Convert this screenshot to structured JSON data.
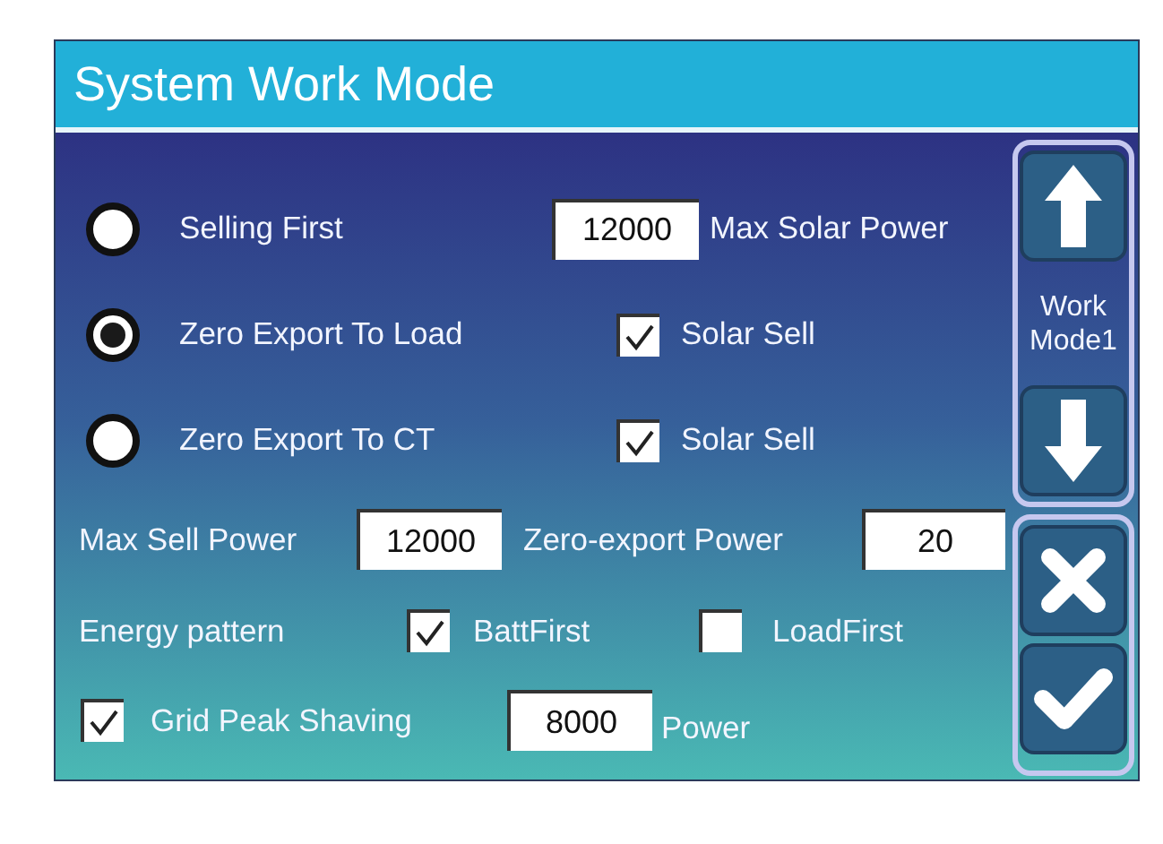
{
  "title": "System Work Mode",
  "modes": [
    {
      "label": "Selling First",
      "selected": false,
      "kind": "field",
      "value": "12000",
      "extra_label": "Max Solar Power"
    },
    {
      "label": "Zero Export To Load",
      "selected": true,
      "kind": "checkbox",
      "checked": true,
      "extra_label": "Solar Sell"
    },
    {
      "label": "Zero Export To CT",
      "selected": false,
      "kind": "checkbox",
      "checked": true,
      "extra_label": "Solar Sell"
    }
  ],
  "sell_power": {
    "label": "Max Sell Power",
    "value": "12000",
    "zero_export_label": "Zero-export Power",
    "zero_export_value": "20"
  },
  "energy_pattern": {
    "label": "Energy pattern",
    "options": [
      {
        "label": "BattFirst",
        "checked": true
      },
      {
        "label": "LoadFirst",
        "checked": false
      }
    ]
  },
  "peak_shaving": {
    "label": "Grid Peak Shaving",
    "checked": true,
    "value": "8000",
    "unit": "Power"
  },
  "side_panel": {
    "mode_label": "Work Mode1"
  }
}
